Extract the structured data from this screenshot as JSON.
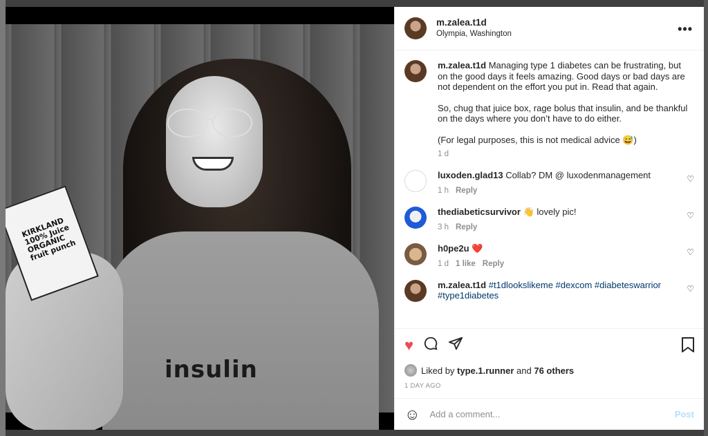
{
  "post": {
    "username": "m.zalea.t1d",
    "location": "Olympia, Washington",
    "more_icon": "more-icon",
    "caption": {
      "username": "m.zalea.t1d",
      "text_1": "Managing type 1 diabetes can be frustrating, but on the good days it feels amazing. Good days or bad days are not dependent on the effort you put in. Read that again.",
      "text_2": "So, chug that juice box, rage bolus that insulin, and be thankful on the days where you don’t have to do either.",
      "text_3": "(For legal purposes, this is not medical advice 😅)",
      "age": "1 d"
    }
  },
  "photo": {
    "shirt_text": "insulin",
    "juice_text": "KIRKLAND 100% Juice ORGANIC fruit punch"
  },
  "comments": [
    {
      "username": "luxoden.glad13",
      "text": "Collab? DM @ luxodenmanagement",
      "age": "1 h",
      "reply": "Reply"
    },
    {
      "username": "thediabeticsurvivor",
      "text": "👋 lovely pic!",
      "age": "3 h",
      "reply": "Reply"
    },
    {
      "username": "h0pe2u",
      "text": "❤️",
      "age": "1 d",
      "likes": "1 like",
      "reply": "Reply"
    },
    {
      "username": "m.zalea.t1d",
      "text": "#t1dlookslikeme #dexcom #diabeteswarrior #type1diabetes"
    }
  ],
  "likes": {
    "prefix": "Liked by",
    "user": "type.1.runner",
    "and": "and",
    "others": "76 others"
  },
  "date": "1 DAY AGO",
  "add_comment": {
    "placeholder": "Add a comment...",
    "post_label": "Post"
  },
  "colors": {
    "like_red": "#ed4956",
    "post_blue": "#b2dffc",
    "tag_blue": "#00376b"
  }
}
